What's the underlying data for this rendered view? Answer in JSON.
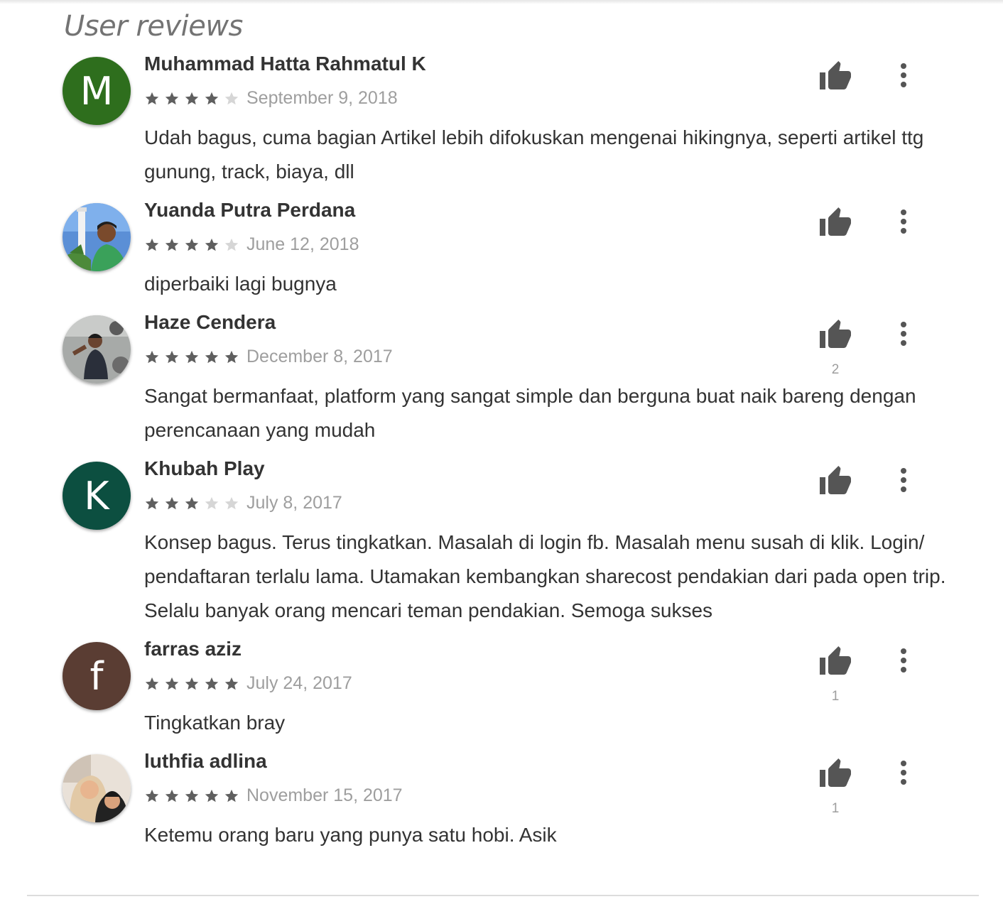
{
  "section": {
    "title": "User reviews"
  },
  "colors": {
    "star_filled": "#5f5f5f",
    "star_empty": "#d6d6d6",
    "icon": "#555555"
  },
  "reviews": [
    {
      "name": "Muhammad Hatta Rahmatul K",
      "avatar_letter": "M",
      "avatar_color": "#2e6e1d",
      "rating": 4,
      "date": "September 9, 2018",
      "text": "Udah bagus, cuma bagian Artikel lebih difokuskan mengenai hikingnya, seperti artikel ttg gunung, track, biaya, dll",
      "likes": ""
    },
    {
      "name": "Yuanda Putra Perdana",
      "avatar_letter": "",
      "avatar_color": "",
      "rating": 4,
      "date": "June 12, 2018",
      "text": "diperbaiki lagi bugnya",
      "likes": ""
    },
    {
      "name": "Haze Cendera",
      "avatar_letter": "",
      "avatar_color": "",
      "rating": 5,
      "date": "December 8, 2017",
      "text": "Sangat bermanfaat, platform yang sangat simple dan berguna buat naik bareng dengan perencanaan yang mudah",
      "likes": "2"
    },
    {
      "name": "Khubah Play",
      "avatar_letter": "K",
      "avatar_color": "#0c4f40",
      "rating": 3,
      "date": "July 8, 2017",
      "text": "Konsep bagus. Terus tingkatkan. Masalah di login fb. Masalah menu susah di klik. Login/ pendaftaran terlalu lama. Utamakan kembangkan sharecost pendakian dari pada open trip. Selalu banyak orang mencari teman pendakian. Semoga sukses",
      "likes": ""
    },
    {
      "name": "farras aziz",
      "avatar_letter": "f",
      "avatar_color": "#5a3d33",
      "rating": 5,
      "date": "July 24, 2017",
      "text": "Tingkatkan bray",
      "likes": "1"
    },
    {
      "name": "luthfia adlina",
      "avatar_letter": "",
      "avatar_color": "",
      "rating": 5,
      "date": "November 15, 2017",
      "text": "Ketemu orang baru yang punya satu hobi. Asik",
      "likes": "1"
    }
  ]
}
